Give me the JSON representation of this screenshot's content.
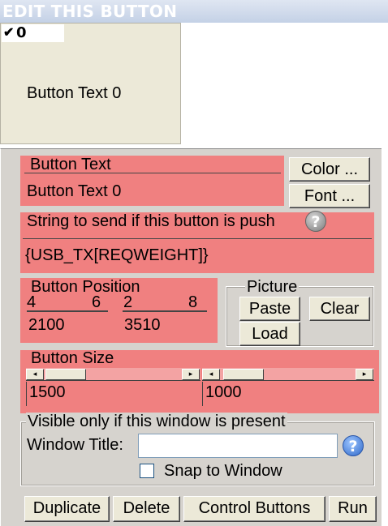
{
  "header": {
    "title": "EDIT THIS BUTTON"
  },
  "preview": {
    "checkbox_value": "0",
    "check_mark": "✔",
    "button_text": "Button Text 0"
  },
  "button_text_group": {
    "label": "Button Text",
    "value": "Button Text 0",
    "color_button": "Color ...",
    "font_button": "Font ..."
  },
  "string_group": {
    "label": "String to send if this button is push",
    "value": "{USB_TX[REQWEIGHT]}",
    "help_icon": "?"
  },
  "position_group": {
    "label": "Button Position",
    "x_ticks": [
      "4",
      "6"
    ],
    "y_ticks": [
      "2",
      "8"
    ],
    "x_value": "2100",
    "y_value": "3510"
  },
  "picture_group": {
    "label": "Picture",
    "paste_button": "Paste",
    "clear_button": "Clear",
    "load_button": "Load"
  },
  "size_group": {
    "label": "Button Size",
    "width_value": "1500",
    "height_value": "1000"
  },
  "visible_group": {
    "label": "Visible only if this window is present",
    "window_title_label": "Window Title:",
    "window_title_value": "",
    "help_icon": "?",
    "snap_label": "Snap to Window"
  },
  "footer": {
    "duplicate_button": "Duplicate",
    "delete_button": "Delete",
    "control_buttons_button": "Control Buttons",
    "run_button": "Run"
  },
  "colors": {
    "highlight_red": "#f08080",
    "panel_gray": "#d6d3ce",
    "button_face": "#ece9d8",
    "title_bar_blue": "#c4d1e6"
  }
}
